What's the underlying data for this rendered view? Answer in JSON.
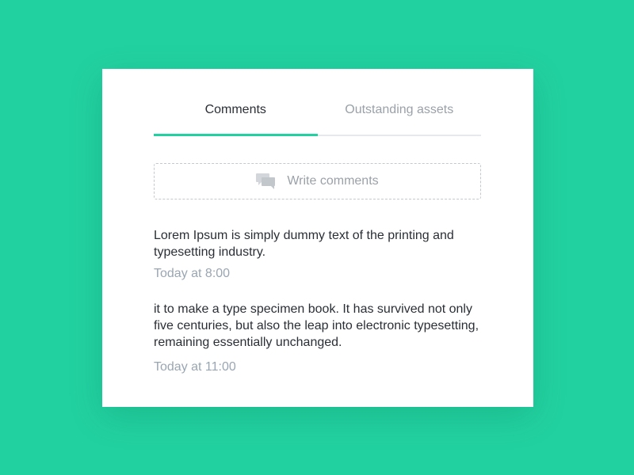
{
  "tabs": [
    {
      "label": "Comments",
      "active": true
    },
    {
      "label": "Outstanding assets",
      "active": false
    }
  ],
  "write": {
    "placeholder": "Write comments",
    "icon": "comments-icon"
  },
  "comments": [
    {
      "text": "Lorem Ipsum is simply dummy text of the printing and typesetting industry.",
      "time": "Today at 8:00"
    },
    {
      "text": "it to make a type specimen book. It has survived not only five centuries, but also the leap into electronic typesetting, remaining essentially unchanged.",
      "time": "Today at 11:00"
    }
  ],
  "colors": {
    "background": "#22d1a0",
    "accent": "#22d1a0",
    "text": "#2a2f36",
    "muted": "#9aa1a8"
  }
}
